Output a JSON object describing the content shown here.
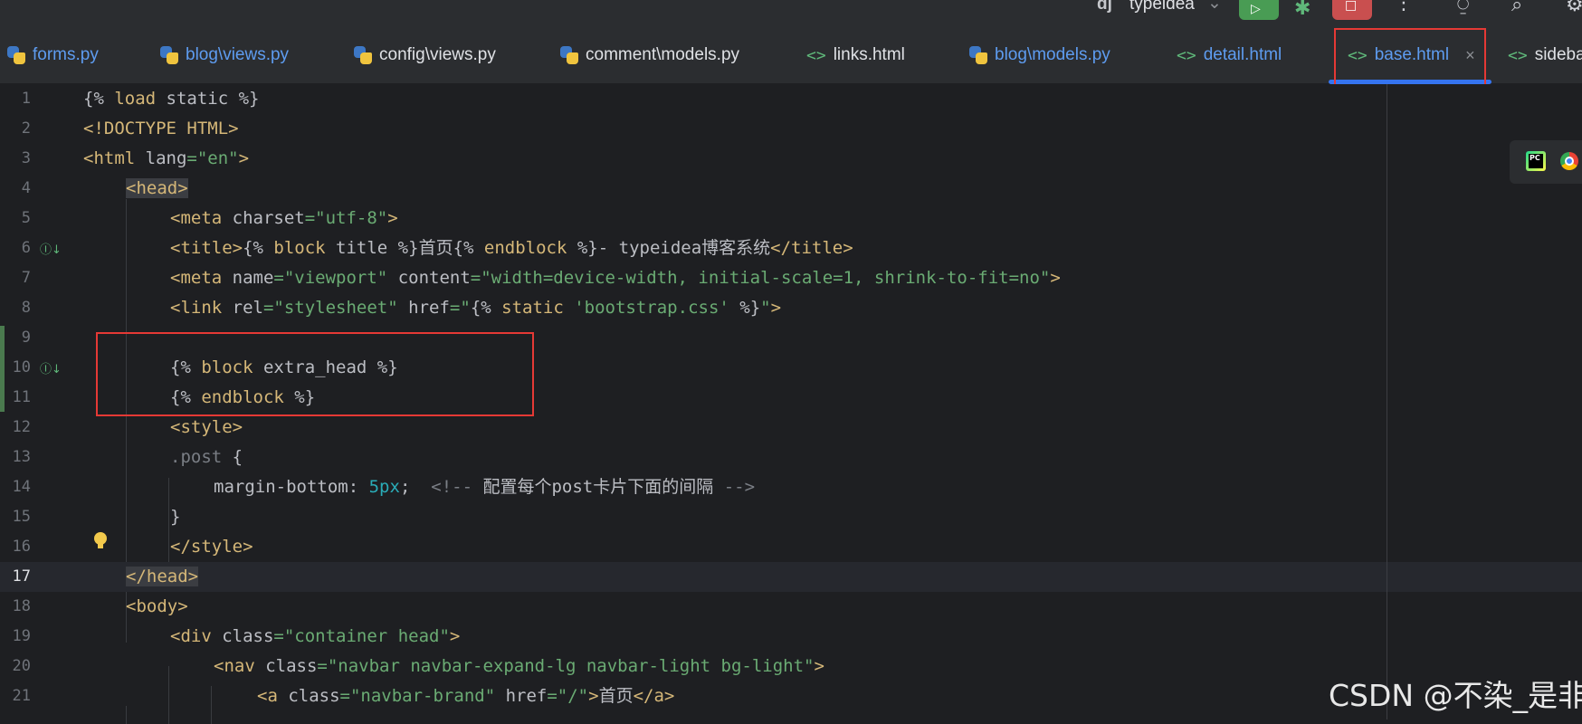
{
  "topbar": {
    "project_icon": "dj",
    "project_name": "typeidea",
    "dropdown_glyph": "⌄"
  },
  "tabs": [
    {
      "label": "forms.py",
      "type": "python",
      "color": "blue"
    },
    {
      "label": "blog\\views.py",
      "type": "python",
      "color": "blue"
    },
    {
      "label": "config\\views.py",
      "type": "python",
      "color": "white"
    },
    {
      "label": "comment\\models.py",
      "type": "python",
      "color": "white"
    },
    {
      "label": "links.html",
      "type": "html",
      "color": "white"
    },
    {
      "label": "blog\\models.py",
      "type": "python",
      "color": "blue"
    },
    {
      "label": "detail.html",
      "type": "html",
      "color": "blue"
    },
    {
      "label": "base.html",
      "type": "html",
      "color": "blue",
      "active": true,
      "close": "×"
    },
    {
      "label": "sideba",
      "type": "html",
      "color": "white"
    }
  ],
  "editor": {
    "current_line": 17,
    "lines": [
      {
        "n": "1"
      },
      {
        "n": "2"
      },
      {
        "n": "3"
      },
      {
        "n": "4"
      },
      {
        "n": "5"
      },
      {
        "n": "6"
      },
      {
        "n": "7"
      },
      {
        "n": "8"
      },
      {
        "n": "9"
      },
      {
        "n": "10"
      },
      {
        "n": "11"
      },
      {
        "n": "12"
      },
      {
        "n": "13"
      },
      {
        "n": "14"
      },
      {
        "n": "15"
      },
      {
        "n": "16"
      },
      {
        "n": "17"
      },
      {
        "n": "18"
      },
      {
        "n": "19"
      },
      {
        "n": "20"
      },
      {
        "n": "21"
      }
    ],
    "code": {
      "l1_a": "{% ",
      "l1_b": "load",
      "l1_c": " static %}",
      "l2": "<!DOCTYPE HTML>",
      "l3_a": "<html ",
      "l3_b": "lang",
      "l3_c": "=",
      "l3_d": "\"en\"",
      "l3_e": ">",
      "l4": "<head>",
      "l5_a": "<meta ",
      "l5_b": "charset",
      "l5_c": "=",
      "l5_d": "\"utf-8\"",
      "l5_e": ">",
      "l6_a": "<title>",
      "l6_b": "{% ",
      "l6_c": "block",
      "l6_d": " title %}",
      "l6_e": "首页",
      "l6_f": "{% ",
      "l6_g": "endblock",
      "l6_h": " %}",
      "l6_i": "- typeidea",
      "l6_j": "博客系统",
      "l6_k": "</title>",
      "l7_a": "<meta ",
      "l7_b": "name",
      "l7_c": "=",
      "l7_d": "\"viewport\"",
      "l7_e": " content",
      "l7_f": "=",
      "l7_g": "\"width=device-width, initial-scale=1, shrink-to-fit=no\"",
      "l7_h": ">",
      "l8_a": "<link ",
      "l8_b": "rel",
      "l8_c": "=",
      "l8_d": "\"stylesheet\"",
      "l8_e": " href",
      "l8_f": "=",
      "l8_g": "\"",
      "l8_h": "{% ",
      "l8_i": "static",
      "l8_j": " ",
      "l8_k": "'bootstrap.css'",
      "l8_l": " %}",
      "l8_m": "\"",
      "l8_n": ">",
      "l10_a": "{% ",
      "l10_b": "block",
      "l10_c": " extra_head %}",
      "l11_a": "{% ",
      "l11_b": "endblock",
      "l11_c": " %}",
      "l12": "<style>",
      "l13_a": ".post",
      "l13_b": " {",
      "l14_a": "margin-bottom",
      "l14_b": ": ",
      "l14_c": "5px",
      "l14_d": ";  ",
      "l14_e": "<!-- ",
      "l14_f": "配置每个",
      "l14_g": "post",
      "l14_h": "卡片下面的间隔",
      "l14_i": " -->",
      "l15": "}",
      "l16": "</style>",
      "l17": "</head>",
      "l18": "<body>",
      "l19_a": "<div ",
      "l19_b": "class",
      "l19_c": "=",
      "l19_d": "\"container head\"",
      "l19_e": ">",
      "l20_a": "<nav ",
      "l20_b": "class",
      "l20_c": "=",
      "l20_d": "\"navbar navbar-expand-lg navbar-light bg-light\"",
      "l20_e": ">",
      "l21_a": "<a ",
      "l21_b": "class",
      "l21_c": "=",
      "l21_d": "\"navbar-brand\"",
      "l21_e": " href",
      "l21_f": "=",
      "l21_g": "\"/\"",
      "l21_h": ">",
      "l21_i": "首页",
      "l21_j": "</a>"
    }
  },
  "gutter_icons": {
    "l6": "Ⓘ↓",
    "l10": "Ⓘ↓"
  },
  "plugins": {
    "pycharm_label": "PC"
  },
  "watermark": "CSDN @不染_是非",
  "colors": {
    "accent": "#3574f0",
    "annotation": "#e53935",
    "keyword": "#d5b778",
    "string": "#6aab73",
    "number": "#2aacb8",
    "comment": "#7a7e85"
  }
}
